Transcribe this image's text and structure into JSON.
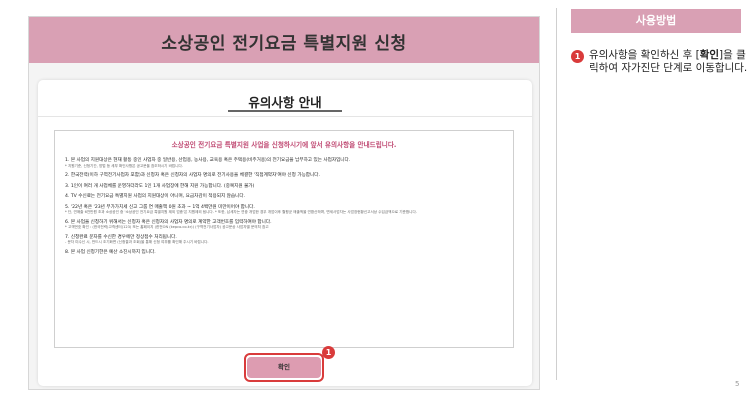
{
  "shot": {
    "title": "소상공인 전기요금 특별지원 신청",
    "card_title": "유의사항 안내",
    "notice_head": "소상공인 전기요금 특별지원 사업을 신청하시기에 앞서 유의사항을 안내드립니다.",
    "items": [
      {
        "text": "1. 본 사업의 지원대상은 현재 활동 중인 사업자 중 일반용, 산업용, 농사용, 교육용 혹은 주택용(비주거용)의 전기요금을 납부하고 있는 사업자입니다.",
        "sub": "* 지원기준, 신청기간, 방법 등 세부 확인사항은 공고문을 참조하시기 바랍니다."
      },
      {
        "text": "2. 한국전력(이하 구역전기사업자 포함)과 신청자 혹은 신청자의 사업자 명의로 전기사용을 체결한 '직접계약자'여야 신청 가능합니다.",
        "sub": ""
      },
      {
        "text": "3. 1인이 여러 개 사업체를 운영하더라도 1인 1개 사업장에 한해 지원 가능합니다. (중복지원 불가)",
        "sub": ""
      },
      {
        "text": "4. TV 수신료는 전기요금 특별지원 사업의 지원대상이 아니며, 요금차감이 적용되지 않습니다.",
        "sub": ""
      },
      {
        "text": "5. '22년 혹은 '23년 부가가치세 신고 그룹 연 매출액 0원 초과 ~ 1억 4백만원 미만이어야 합니다.",
        "sub": "* 단, 연매출 6천만원 초과 소상공인 중 '소상공인 전기요금 특별지원 제외 업종'은 지원제외 됩니다. * 또한, 납세자는 연중 개업한 경우 개업이후 월평균 매출액을 연환산하며, 면세사업자는 사업장현황신고서상 수입금액으로 기준합니다."
      },
      {
        "text": "6. 본 사업을 신청하기 위해서는 신청자 혹은 신청자의 사업자 명의로 계약한 고객번호를 입력하여야 합니다.",
        "sub": "* 고객번호 확인 : (한국전력)고객센터(123) 또는 홈페이지 (한전ON (kepco.co.kr)) (구역전기사업자) 공고문상 사업자별 문의처 참고"
      },
      {
        "text": "7. 신청완료 문자를 수신한 경우에만 정상접수 처리됩니다.",
        "sub": "- 문자 미수신 시, 반드시 조기화면 (신청결과 조회)을 통해 신청 여부를 확인해 주시기 바랍니다."
      },
      {
        "text": "8. 본 사업 신청기한은 예산 소진시까지 입니다.",
        "sub": ""
      }
    ],
    "confirm_label": "확인",
    "marker": "1"
  },
  "side": {
    "heading": "사용방법",
    "step_marker": "1",
    "step_pre": "유의사항을 확인하신 후 [",
    "step_bold": "확인",
    "step_post": "]을 클릭하여 자가진단 단계로 이동합니다."
  },
  "page_number": "5",
  "colors": {
    "header_pink": "#d9a0b4",
    "button_pink": "#dd9cb1",
    "marker_red": "#d93b3b",
    "notice_head": "#c04a73"
  }
}
